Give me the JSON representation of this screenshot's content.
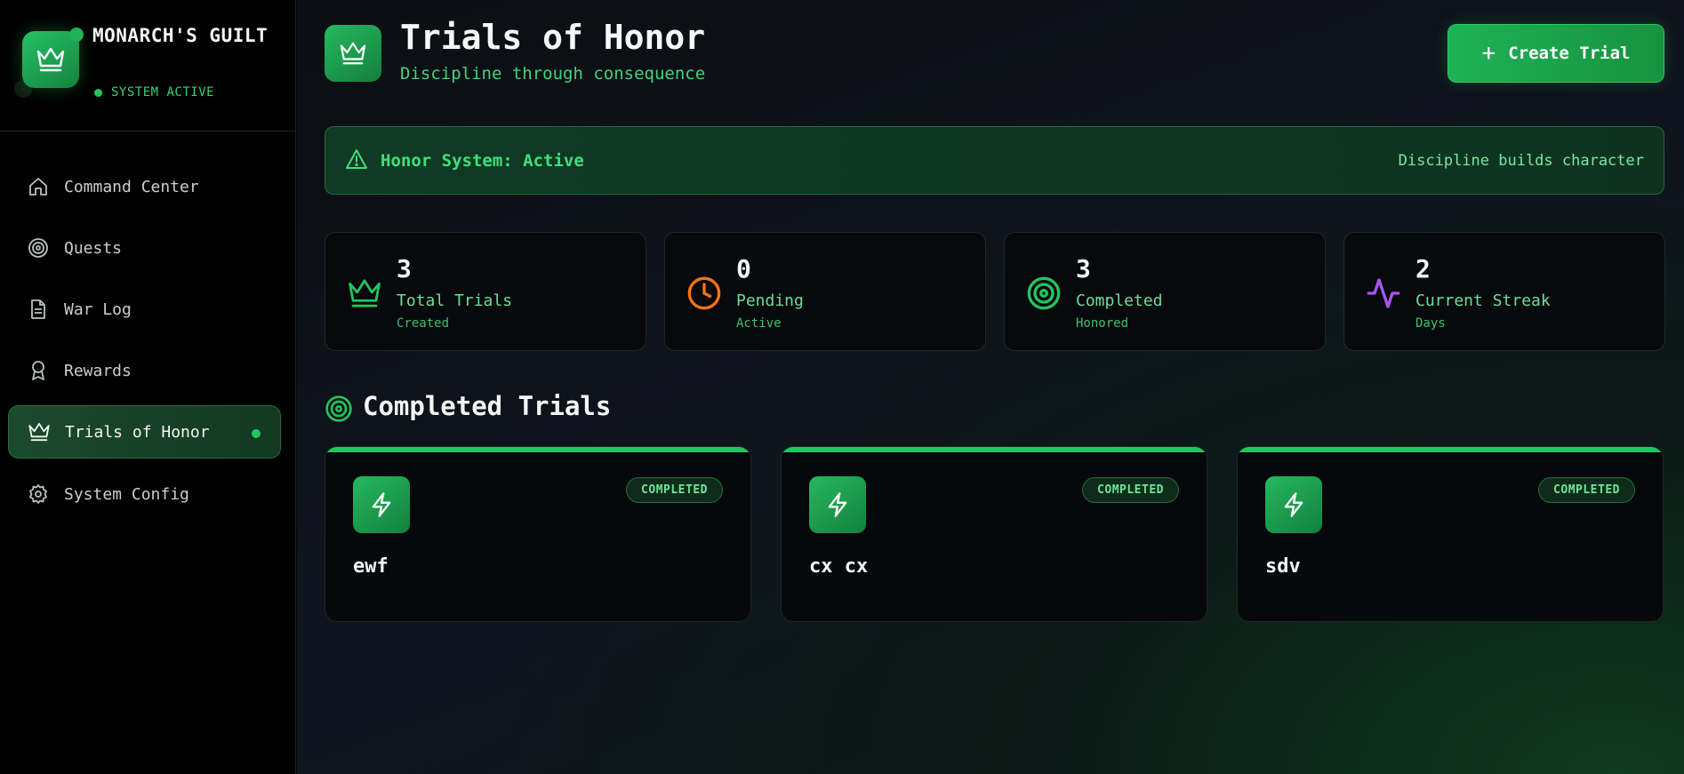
{
  "sidebar": {
    "brand": {
      "title": "MONARCH'S GUILT",
      "status": "SYSTEM ACTIVE"
    },
    "items": [
      {
        "label": "Command Center",
        "icon": "home-icon"
      },
      {
        "label": "Quests",
        "icon": "target-icon"
      },
      {
        "label": "War Log",
        "icon": "document-icon"
      },
      {
        "label": "Rewards",
        "icon": "award-icon"
      },
      {
        "label": "Trials of Honor",
        "icon": "crown-icon",
        "active": true
      },
      {
        "label": "System Config",
        "icon": "gear-icon"
      }
    ]
  },
  "header": {
    "title": "Trials of Honor",
    "subtitle": "Discipline through consequence",
    "create_label": "Create Trial"
  },
  "banner": {
    "title": "Honor System: Active",
    "motto": "Discipline builds character"
  },
  "stats": [
    {
      "value": "3",
      "label": "Total Trials",
      "sub": "Created",
      "icon": "crown-icon",
      "color": "#22c55e"
    },
    {
      "value": "0",
      "label": "Pending",
      "sub": "Active",
      "icon": "clock-icon",
      "color": "#f97316"
    },
    {
      "value": "3",
      "label": "Completed",
      "sub": "Honored",
      "icon": "target-icon",
      "color": "#22c55e"
    },
    {
      "value": "2",
      "label": "Current Streak",
      "sub": "Days",
      "icon": "activity-icon",
      "color": "#a855f7"
    }
  ],
  "section": {
    "title": "Completed Trials"
  },
  "trials": [
    {
      "name": "ewf",
      "status": "COMPLETED"
    },
    {
      "name": "cx cx",
      "status": "COMPLETED"
    },
    {
      "name": "sdv",
      "status": "COMPLETED"
    }
  ],
  "colors": {
    "accent": "#22c55e",
    "background": "#050608"
  }
}
